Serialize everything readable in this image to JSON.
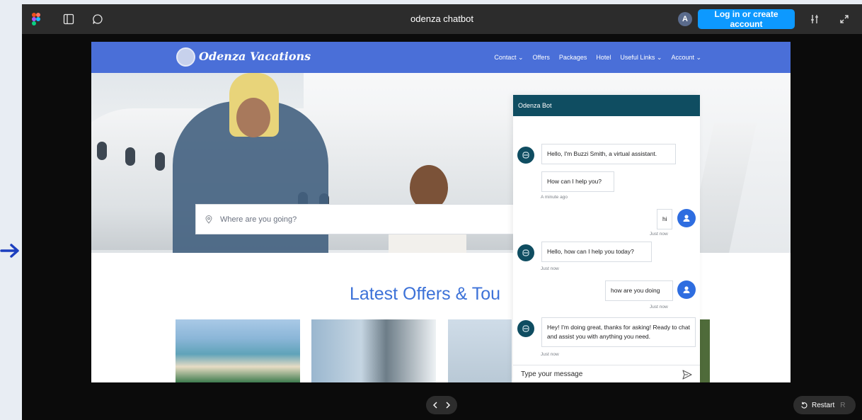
{
  "topbar": {
    "file_title": "odenza chatbot",
    "avatar_initial": "A",
    "login_label": "Log in or create account",
    "icons": [
      "figma-logo-icon",
      "sidebar-panel-icon",
      "comment-icon",
      "settings-sliders-icon",
      "expand-icon"
    ]
  },
  "site": {
    "logo_text": "Odenza Vacations",
    "nav": [
      "Contact ⌄",
      "Offers",
      "Packages",
      "Hotel",
      "Useful Links ⌄",
      "Account ⌄"
    ],
    "search_placeholder": "Where are you going?",
    "offers_title": "Latest Offers & Tou"
  },
  "chat": {
    "header": "Odenza Bot",
    "messages": [
      {
        "from": "bot",
        "text": "Hello, I'm Buzzi Smith, a virtual assistant."
      },
      {
        "from": "bot",
        "text": "How can I help you?",
        "time": "A minute ago"
      },
      {
        "from": "user",
        "text": "hi",
        "time": "Just now"
      },
      {
        "from": "bot",
        "text": "Hello, how can I help you today?",
        "time": "Just now"
      },
      {
        "from": "user",
        "text": "how are you doing",
        "time": "Just now"
      },
      {
        "from": "bot",
        "text": "Hey! I'm doing great, thanks for asking! Ready to chat and assist you with anything you need.",
        "time": "Just now"
      }
    ],
    "input_placeholder": "Type your message"
  },
  "footer": {
    "restart_label": "Restart",
    "restart_key": "R"
  },
  "colors": {
    "brand_blue": "#4a6fd8",
    "chat_header": "#0f4d61",
    "login_button": "#0d99ff",
    "user_avatar": "#2e6de0"
  }
}
